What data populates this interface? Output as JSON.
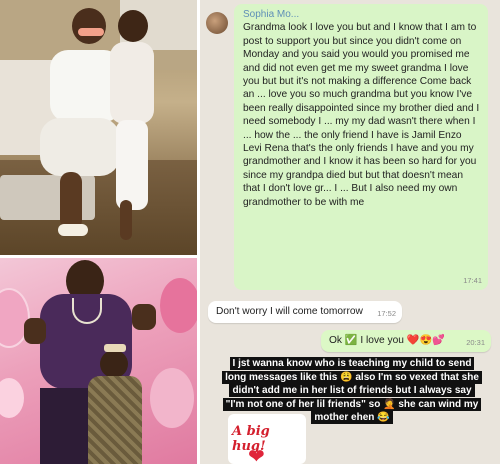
{
  "chat": {
    "sender_name": "Sophia Mo...",
    "messages": [
      {
        "text": "Grandma look I love you but and I know that I am to post to support you but since you didn't come on Monday and you said you would you promised me and did not even get me my sweet grandma I love you but but it's not making a difference Come back an ... love you so much grandma but you know I've been really disappointed since my brother died and I need somebody I ... my my dad wasn't there when I ... how the ... the only friend I have is Jamil Enzo Levi Rena that's the only friends I have and you my grandmother and I know it has been so hard for you since my grandpa died but but that doesn't mean that I don't love gr... I ... But I also need my own grandmother to be with me",
        "time": "17:41"
      },
      {
        "text": "Don't worry I will come tomorrow",
        "time": "17:52"
      },
      {
        "text": "Ok ✅ I love you ❤️😍💕",
        "time": "20:31"
      }
    ],
    "caption": "I jst wanna know who is teaching my child to send long messages like this 😩 also I'm so vexed that she didn't add me in her list of friends but I always say \"I'm not one of her lil friends\" so 🤦 she can wind my mother ehen 😂",
    "sticker_text": "A big hug!"
  }
}
